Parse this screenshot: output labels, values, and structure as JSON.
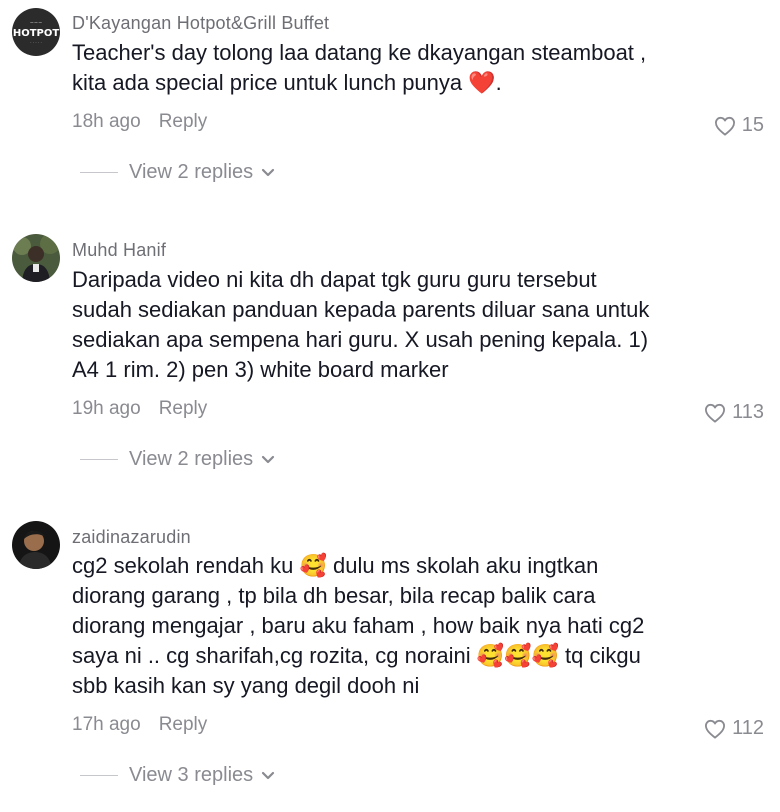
{
  "comments": [
    {
      "username": "D'Kayangan Hotpot&Grill Buffet",
      "avatar_text": "HOTPOT",
      "lines": [
        "Teacher's day tolong laa datang ke dkayangan steamboat ,",
        "kita ada special price untuk lunch punya ❤️."
      ],
      "time": "18h ago",
      "reply_label": "Reply",
      "likes": "15",
      "view_replies": "View 2 replies"
    },
    {
      "username": "Muhd Hanif",
      "lines": [
        "Daripada video ni kita dh dapat tgk guru guru tersebut",
        "sudah sediakan panduan kepada parents diluar sana untuk",
        "sediakan apa sempena hari guru. X usah pening kepala. 1)",
        "A4 1 rim. 2) pen 3) white board marker"
      ],
      "time": "19h ago",
      "reply_label": "Reply",
      "likes": "113",
      "view_replies": "View 2 replies"
    },
    {
      "username": "zaidinazarudin",
      "lines": [
        "cg2 sekolah rendah ku 🥰 dulu ms skolah aku ingtkan",
        "diorang garang , tp bila dh besar, bila recap balik cara",
        "diorang mengajar , baru aku faham , how baik nya hati cg2",
        "saya ni .. cg sharifah,cg rozita, cg noraini 🥰🥰🥰 tq cikgu",
        "sbb kasih kan sy yang degil dooh ni"
      ],
      "time": "17h ago",
      "reply_label": "Reply",
      "likes": "112",
      "view_replies": "View 3 replies"
    }
  ]
}
